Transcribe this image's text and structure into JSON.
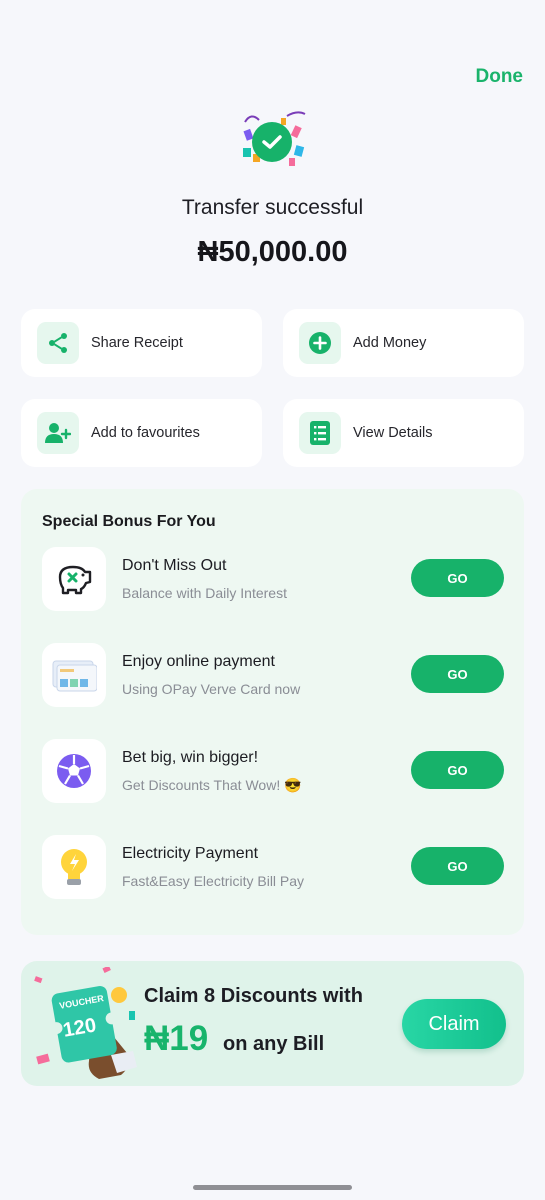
{
  "header": {
    "done_label": "Done"
  },
  "status": {
    "title": "Transfer successful",
    "amount": "₦50,000.00"
  },
  "actions": [
    {
      "label": "Share Receipt",
      "icon": "share-icon"
    },
    {
      "label": "Add Money",
      "icon": "plus-circle-icon"
    },
    {
      "label": "Add to favourites",
      "icon": "add-user-icon"
    },
    {
      "label": "View Details",
      "icon": "document-icon"
    }
  ],
  "bonus": {
    "heading": "Special Bonus For You",
    "items": [
      {
        "title": "Don't Miss Out",
        "subtitle": "Balance with Daily Interest",
        "button": "GO",
        "icon": "piggy-bank-icon"
      },
      {
        "title": "Enjoy online payment",
        "subtitle": "Using OPay Verve Card now",
        "button": "GO",
        "icon": "cards-icon"
      },
      {
        "title": "Bet big, win bigger!",
        "subtitle": "Get Discounts That Wow! 😎",
        "button": "GO",
        "icon": "football-icon"
      },
      {
        "title": "Electricity Payment",
        "subtitle": "Fast&Easy Electricity Bill Pay",
        "button": "GO",
        "icon": "lightbulb-icon"
      }
    ]
  },
  "promo": {
    "voucher_label": "VOUCHER",
    "voucher_value": "120",
    "line1": "Claim 8 Discounts with",
    "price": "₦19",
    "line2": "on any Bill",
    "claim_label": "Claim"
  },
  "colors": {
    "accent": "#17b26a",
    "background": "#f6f7fb",
    "panel": "#eef8f2",
    "promo": "#dff3ea"
  }
}
